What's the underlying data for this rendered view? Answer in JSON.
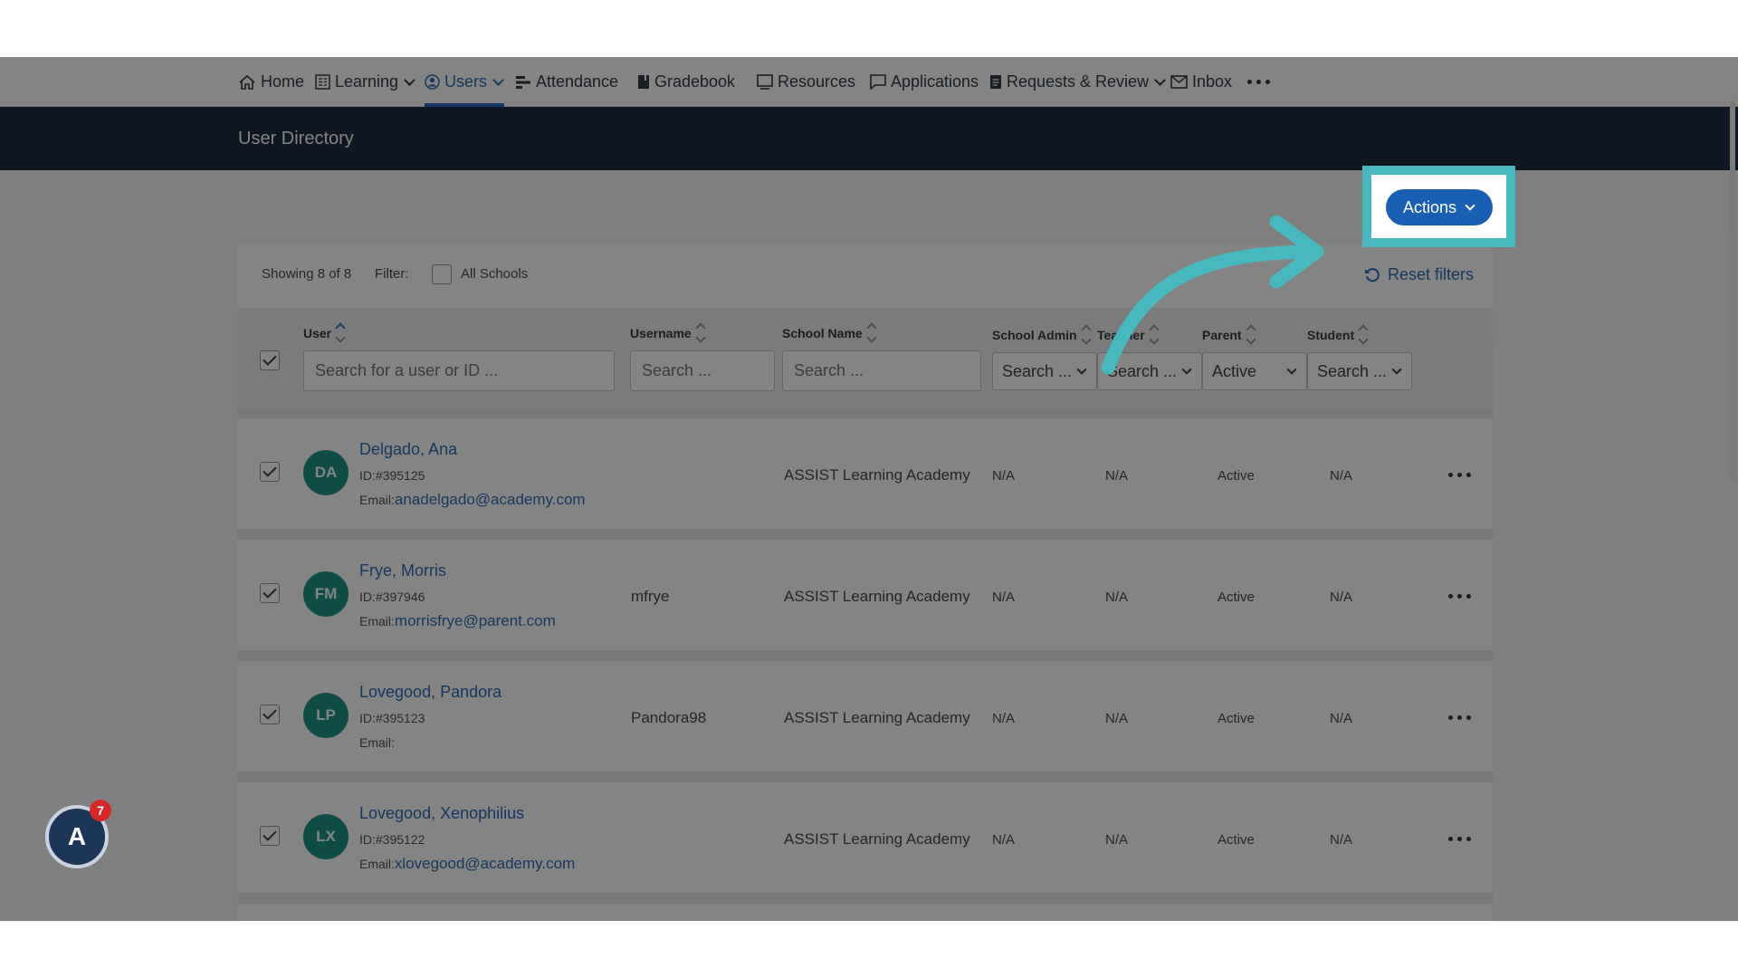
{
  "nav": {
    "items": [
      {
        "label": "Home",
        "icon": "home-icon"
      },
      {
        "label": "Learning",
        "icon": "learning-icon"
      },
      {
        "label": "Users",
        "icon": "user-icon"
      },
      {
        "label": "Attendance",
        "icon": "attendance-icon"
      },
      {
        "label": "Gradebook",
        "icon": "gradebook-icon"
      },
      {
        "label": "Resources",
        "icon": "resources-icon"
      },
      {
        "label": "Applications",
        "icon": "applications-icon"
      },
      {
        "label": "Requests & Review",
        "icon": "requests-icon"
      },
      {
        "label": "Inbox",
        "icon": "inbox-icon"
      }
    ],
    "active": "Users"
  },
  "header": {
    "title": "User Directory"
  },
  "actions": {
    "label": "Actions"
  },
  "filter": {
    "showing": "Showing 8 of 8",
    "filter_label": "Filter:",
    "all_schools": "All Schools",
    "reset": "Reset filters"
  },
  "columns": {
    "user": "User",
    "username": "Username",
    "school": "School Name",
    "admin": "School Admin",
    "teacher": "Teacher",
    "parent": "Parent",
    "student": "Student"
  },
  "search": {
    "user_placeholder": "Search for a user or ID ...",
    "generic_placeholder": "Search ...",
    "admin_value": "Search ...",
    "teacher_value": "Search ...",
    "parent_value": "Active",
    "student_value": "Search ..."
  },
  "rows": [
    {
      "initials": "DA",
      "name": "Delgado, Ana",
      "id": "ID:#395125",
      "email_label": "Email:",
      "email": "anadelgado@academy.com",
      "username": "",
      "school": "ASSIST Learning Academy",
      "admin": "N/A",
      "teacher": "N/A",
      "parent": "Active",
      "student": "N/A"
    },
    {
      "initials": "FM",
      "name": "Frye, Morris",
      "id": "ID:#397946",
      "email_label": "Email:",
      "email": "morrisfrye@parent.com",
      "username": "mfrye",
      "school": "ASSIST Learning Academy",
      "admin": "N/A",
      "teacher": "N/A",
      "parent": "Active",
      "student": "N/A"
    },
    {
      "initials": "LP",
      "name": "Lovegood, Pandora",
      "id": "ID:#395123",
      "email_label": "Email:",
      "email": "",
      "username": "Pandora98",
      "school": "ASSIST Learning Academy",
      "admin": "N/A",
      "teacher": "N/A",
      "parent": "Active",
      "student": "N/A"
    },
    {
      "initials": "LX",
      "name": "Lovegood, Xenophilius",
      "id": "ID:#395122",
      "email_label": "Email:",
      "email": "xlovegood@academy.com",
      "username": "",
      "school": "ASSIST Learning Academy",
      "admin": "N/A",
      "teacher": "N/A",
      "parent": "Active",
      "student": "N/A"
    }
  ],
  "help_badge": {
    "count": "7"
  },
  "colors": {
    "accent": "#1a5fb4",
    "header": "#0b1f33",
    "highlight": "#47b9be",
    "avatar": "#0e8a7e"
  }
}
